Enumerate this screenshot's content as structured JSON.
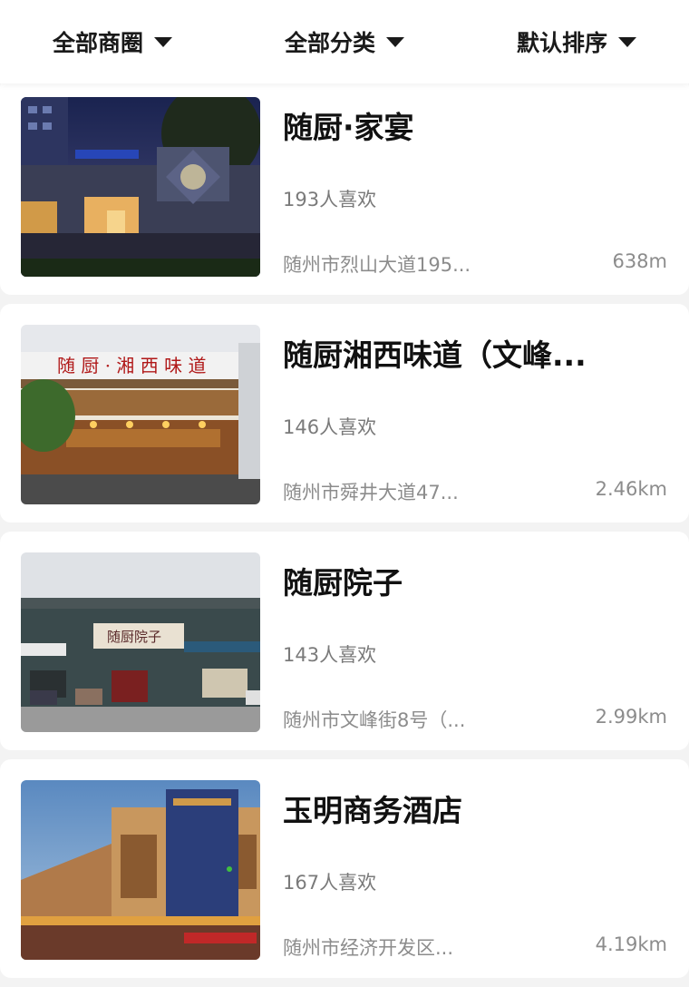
{
  "filters": [
    {
      "label": "全部商圈"
    },
    {
      "label": "全部分类"
    },
    {
      "label": "默认排序"
    }
  ],
  "shops": [
    {
      "name": "随厨·家宴",
      "likes": "193人喜欢",
      "address": "随州市烈山大道195...",
      "distance": "638m"
    },
    {
      "name": "随厨湘西味道（文峰...",
      "likes": "146人喜欢",
      "address": "随州市舜井大道47...",
      "distance": "2.46km"
    },
    {
      "name": "随厨院子",
      "likes": "143人喜欢",
      "address": "随州市文峰街8号（...",
      "distance": "2.99km"
    },
    {
      "name": "玉明商务酒店",
      "likes": "167人喜欢",
      "address": "随州市经济开发区...",
      "distance": "4.19km"
    }
  ]
}
